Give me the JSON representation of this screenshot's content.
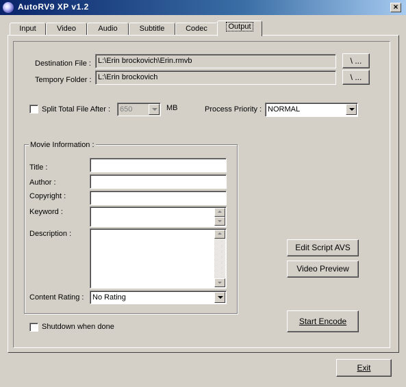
{
  "window": {
    "title": "AutoRV9 XP v1.2",
    "close_glyph": "×"
  },
  "tabs": [
    {
      "label": "Input"
    },
    {
      "label": "Video"
    },
    {
      "label": "Audio"
    },
    {
      "label": "Subtitle"
    },
    {
      "label": "Codec"
    },
    {
      "label": "Output"
    }
  ],
  "active_tab": "Output",
  "destination": {
    "label": "Destination File :",
    "value": "L:\\Erin brockovich\\Erin.rmvb",
    "browse_label": "\\ ..."
  },
  "temp_folder": {
    "label": "Tempory Folder :",
    "value": "L:\\Erin brockovich",
    "browse_label": "\\ ..."
  },
  "split": {
    "label": "Split Total File After :",
    "checked": false,
    "value": "650",
    "unit": "MB"
  },
  "priority": {
    "label": "Process Priority :",
    "value": "NORMAL"
  },
  "movie_info": {
    "title": "Movie Information :",
    "fields": {
      "title_label": "Title :",
      "author_label": "Author :",
      "copyright_label": "Copyright :",
      "keyword_label": "Keyword :",
      "description_label": "Description :",
      "rating_label": "Content Rating :",
      "rating_value": "No Rating"
    }
  },
  "shutdown": {
    "label": "Shutdown when done",
    "checked": false
  },
  "buttons": {
    "edit_script": "Edit Script AVS",
    "video_preview": "Video Preview",
    "start_encode": "Start Encode",
    "exit": "Exit"
  }
}
